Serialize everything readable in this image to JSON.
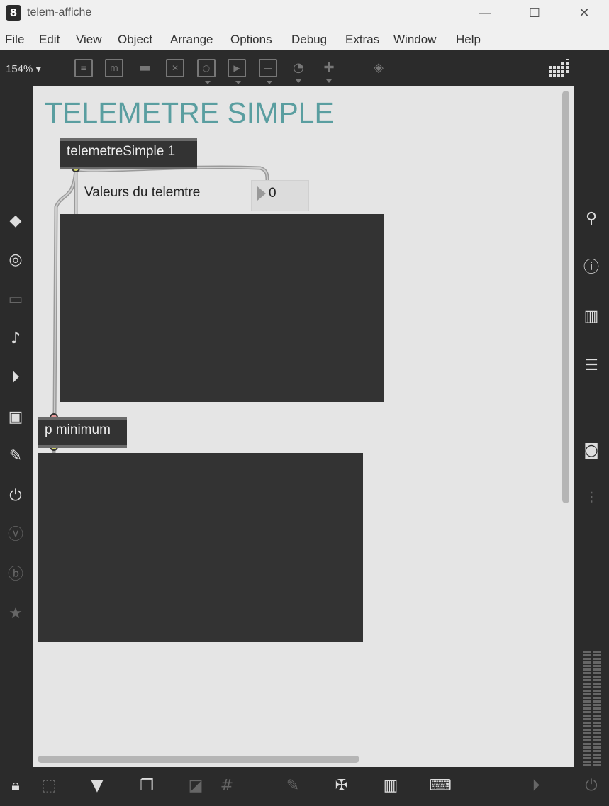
{
  "window": {
    "title": "telem-affiche",
    "minimize": "—",
    "maximize": "☐",
    "close": "✕"
  },
  "menu": [
    "File",
    "Edit",
    "View",
    "Object",
    "Arrange",
    "Options",
    "Debug",
    "Extras",
    "Window",
    "Help"
  ],
  "toolbar": {
    "zoom": "154% ▾"
  },
  "patch": {
    "title": "TELEMETRE SIMPLE",
    "objects": {
      "telemetre": "telemetreSimple 1",
      "minimum": "p minimum"
    },
    "comment": "Valeurs du telemtre",
    "number_value": "0"
  },
  "icons": {
    "left_sidebar": [
      "cube-icon",
      "target-icon",
      "tape-icon",
      "music-note-icon",
      "media-icon",
      "image-icon",
      "paperclip-icon",
      "plug-icon",
      "v-icon",
      "b-icon",
      "star-icon"
    ],
    "right_sidebar": [
      "search-icon",
      "info-icon",
      "book-icon",
      "list-icon",
      "camera-icon",
      "mixer-icon"
    ],
    "bottom_bar": [
      "lock-icon",
      "pointer-icon",
      "presentation-icon",
      "windows-icon",
      "hide-icon",
      "grid-icon",
      "add-clip-icon",
      "wrench-icon",
      "piano-icon",
      "keyboard-icon",
      "play-icon",
      "power-icon"
    ]
  }
}
